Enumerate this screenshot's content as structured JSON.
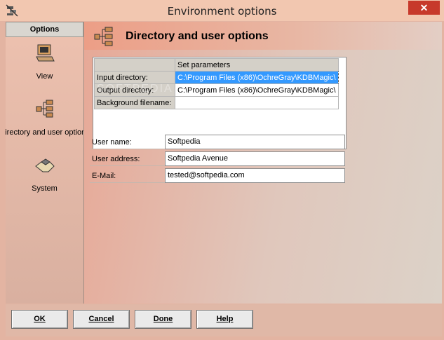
{
  "window": {
    "title": "Environment options",
    "close_label": "✕"
  },
  "sidebar": {
    "header": "Options",
    "items": [
      {
        "label": "View",
        "icon": "computer-icon"
      },
      {
        "label": "Directory and user options",
        "icon": "directory-tree-icon"
      },
      {
        "label": "System",
        "icon": "system-handshake-icon"
      }
    ]
  },
  "main": {
    "title": "Directory and user options",
    "title_icon": "directory-tree-icon",
    "grid": {
      "column_header": "Set parameters",
      "rows": [
        {
          "label": "Input directory:",
          "value": "C:\\Program Files (x86)\\OchreGray\\KDBMagic\\"
        },
        {
          "label": "Output directory:",
          "value": "C:\\Program Files (x86)\\OchreGray\\KDBMagic\\"
        },
        {
          "label": "Background filename:",
          "value": ""
        }
      ]
    },
    "fields": {
      "user_name": {
        "label": "User name:",
        "value": "Softpedia"
      },
      "user_address": {
        "label": "User address:",
        "value": "Softpedia Avenue"
      },
      "email": {
        "label": "E-Mail:",
        "value": "tested@softpedia.com"
      }
    }
  },
  "buttons": {
    "ok": "OK",
    "cancel": "Cancel",
    "done": "Done",
    "help": "Help"
  },
  "watermark": "SOFTPEDIA",
  "colors": {
    "selection": "#3399ff",
    "close": "#c7392b",
    "panel": "#d4d0c8"
  }
}
